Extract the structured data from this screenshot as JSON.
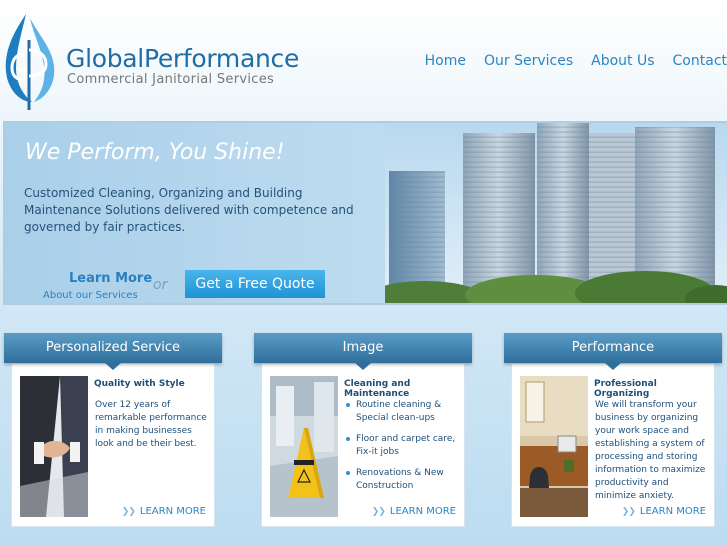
{
  "header": {
    "brand_left": "Global",
    "brand_right": "Performance",
    "tagline": "Commercial Janitorial Services"
  },
  "nav": [
    {
      "label": "Home"
    },
    {
      "label": "Our Services"
    },
    {
      "label": "About Us"
    },
    {
      "label": "Contact"
    }
  ],
  "hero": {
    "title": "We Perform, You Shine!",
    "description": "Customized Cleaning, Organizing and Building Maintenance Solutions delivered with competence and governed by fair practices.",
    "learn_more": "Learn More",
    "about_services": "About our Services",
    "or": "or",
    "quote_button": "Get a Free Quote"
  },
  "panels": [
    {
      "title": "Personalized Service",
      "heading": "Quality with Style",
      "text": "Over 12 years of remarkable performance in making businesses look and be their best.",
      "more": "LEARN MORE"
    },
    {
      "title": "Image",
      "heading": "Cleaning and Maintenance",
      "items": [
        "Routine cleaning & Special clean-ups",
        "Floor and carpet care, Fix-it jobs",
        "Renovations & New Construction"
      ],
      "more": "LEARN MORE"
    },
    {
      "title": "Performance",
      "heading": "Professional Organizing",
      "text": "We will transform your business by organizing your work space and establishing a system of processing and storing information to maximize productivity and minimize anxiety.",
      "more": "LEARN MORE"
    }
  ],
  "colors": {
    "brand_blue": "#1f6da6",
    "link_blue": "#2a86c4",
    "button_blue": "#1f93d5",
    "panel_head": "#2f6f9c"
  }
}
